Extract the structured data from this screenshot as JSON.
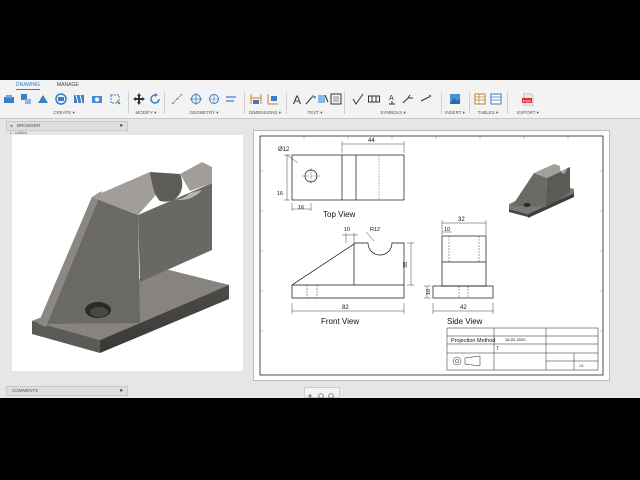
{
  "tabs": [
    "DRAWING",
    "MANAGE"
  ],
  "toolbar_groups": {
    "create": "CREATE ▾",
    "modify": "MODIFY ▾",
    "geometry": "GEOMETRY ▾",
    "dimensions": "DIMENSIONS ▾",
    "text": "TEXT ▾",
    "symbols": "SYMBOLS ▾",
    "insert": "INSERT ▾",
    "tables": "TABLES ▾",
    "export": "EXPORT ▾"
  },
  "browser": {
    "label": "BROWSER",
    "item": "Untitled"
  },
  "comments": {
    "label": "COMMENTS"
  },
  "drawing": {
    "views": {
      "top": "Top View",
      "front": "Front View",
      "side": "Side View"
    },
    "dims": {
      "hole_dia": "Ø12",
      "top_width": "44",
      "top_16_left": "16",
      "top_16_bottom": "16",
      "front_10": "10",
      "front_r12": "R12",
      "front_35": "35",
      "front_82": "82",
      "side_32": "32",
      "side_10_top": "10",
      "side_10_left": "10",
      "side_42": "42"
    },
    "title_block": {
      "title": "Projection Method",
      "date": "16-02-2020",
      "sheet_no": "7",
      "scale": "1/1"
    }
  },
  "colors": {
    "accent": "#2a7fd4",
    "part": "#6f6c68"
  }
}
